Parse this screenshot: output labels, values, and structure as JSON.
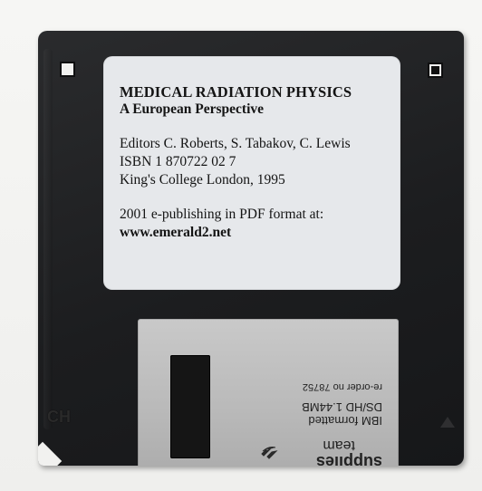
{
  "label": {
    "title": "MEDICAL RADIATION PHYSICS",
    "subtitle": "A European Perspective",
    "editors": "Editors C. Roberts, S. Tabakov, C. Lewis",
    "isbn": "ISBN 1 870722 02 7",
    "publisher": "King's College London, 1995",
    "publishing_note": "2001 e-publishing in PDF format at:",
    "website": "www.emerald2.net"
  },
  "shutter": {
    "brand": "supplies",
    "brand_sub": "team",
    "format_line": "IBM formatted",
    "capacity_line": "DS/HD 1.44MB",
    "reorder_line": "re-order no 78752"
  },
  "disk_logo": "CH",
  "colors": {
    "disk_body": "#1c1d1f",
    "label_paper": "#e6e8eb",
    "shutter_metal": "#b9b9b9",
    "background": "#f4f4f2"
  },
  "icons": [
    "write-protect-hole",
    "density-hole",
    "hand-logo-icon",
    "insert-arrow-icon"
  ]
}
